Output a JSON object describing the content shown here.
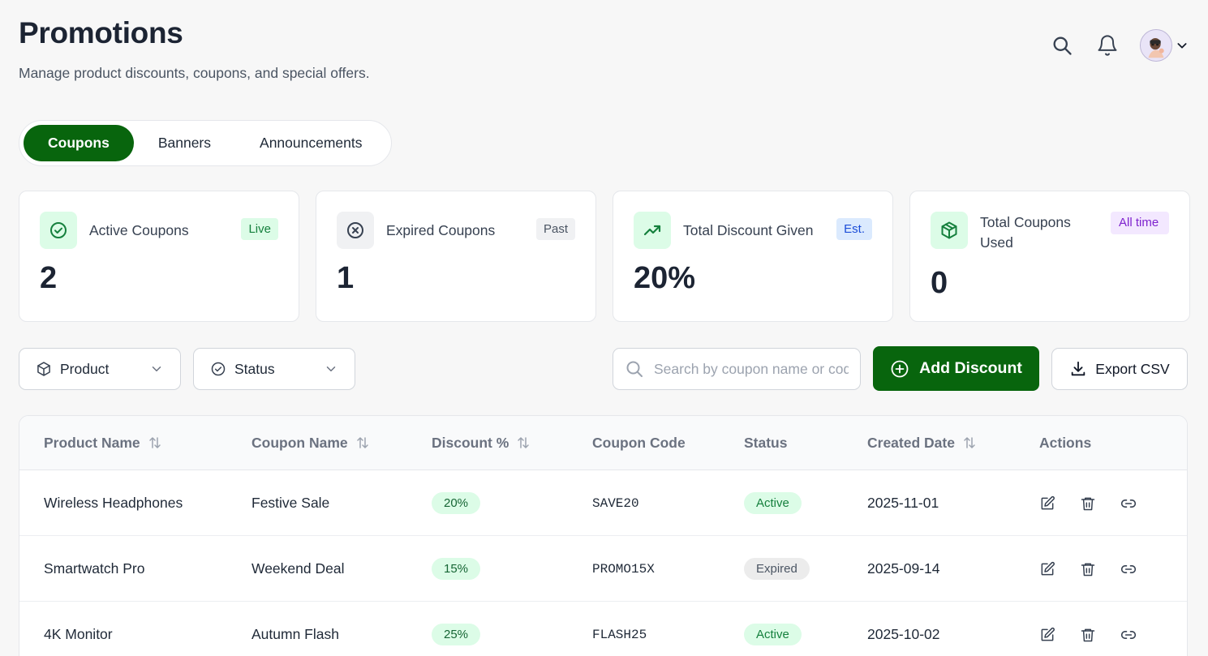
{
  "header": {
    "title": "Promotions",
    "subtitle": "Manage product discounts, coupons, and special offers."
  },
  "top_actions": {
    "search_icon": "search-icon",
    "notification_icon": "bell-icon",
    "avatar_icon": "user-avatar"
  },
  "tabs": [
    {
      "label": "Coupons",
      "active": true
    },
    {
      "label": "Banners",
      "active": false
    },
    {
      "label": "Announcements",
      "active": false
    }
  ],
  "stats": [
    {
      "label": "Active Coupons",
      "badge": "Live",
      "value": "2",
      "icon": "check-circle-icon"
    },
    {
      "label": "Expired Coupons",
      "badge": "Past",
      "value": "1",
      "icon": "x-circle-icon"
    },
    {
      "label": "Total Discount Given",
      "badge": "Est.",
      "value": "20%",
      "icon": "trending-up-icon"
    },
    {
      "label": "Total Coupons Used",
      "badge": "All time",
      "value": "0",
      "icon": "package-icon"
    }
  ],
  "filters": {
    "product_label": "Product",
    "status_label": "Status"
  },
  "search": {
    "placeholder": "Search by coupon name or code",
    "value": ""
  },
  "buttons": {
    "add_discount": "Add Discount",
    "export_csv": "Export CSV"
  },
  "table": {
    "columns": [
      "Product Name",
      "Coupon Name",
      "Discount %",
      "Coupon Code",
      "Status",
      "Created Date",
      "Actions"
    ],
    "rows": [
      {
        "product": "Wireless Headphones",
        "coupon": "Festive Sale",
        "discount": "20%",
        "code": "SAVE20",
        "status": "Active",
        "created": "2025-11-01"
      },
      {
        "product": "Smartwatch Pro",
        "coupon": "Weekend Deal",
        "discount": "15%",
        "code": "PROMO15X",
        "status": "Expired",
        "created": "2025-09-14"
      },
      {
        "product": "4K Monitor",
        "coupon": "Autumn Flash",
        "discount": "25%",
        "code": "FLASH25",
        "status": "Active",
        "created": "2025-10-02"
      }
    ]
  },
  "colors": {
    "primary": "#08650d",
    "active_bg": "#dcfce7",
    "expired_bg": "#ececec",
    "est_badge_bg": "#dbeafe",
    "alltime_badge_bg": "#f3e8ff"
  }
}
